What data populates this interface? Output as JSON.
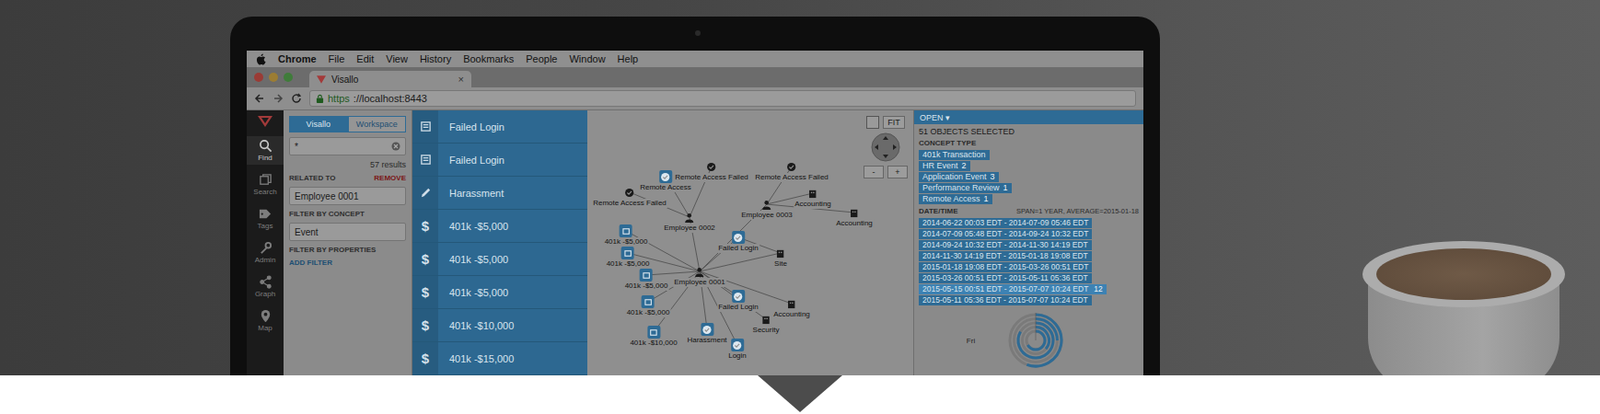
{
  "menubar": {
    "app": "Chrome",
    "items": [
      "File",
      "Edit",
      "View",
      "History",
      "Bookmarks",
      "People",
      "Window",
      "Help"
    ]
  },
  "browser": {
    "tab": {
      "title": "Visallo",
      "close": "×"
    },
    "url": {
      "scheme": "https",
      "rest": "://localhost:8443"
    }
  },
  "nav": [
    {
      "label": "Find",
      "selected": true
    },
    {
      "label": "Search",
      "selected": false
    },
    {
      "label": "Tags",
      "selected": false
    },
    {
      "label": "Admin",
      "selected": false
    },
    {
      "label": "Graph",
      "selected": false
    },
    {
      "label": "Map",
      "selected": false
    }
  ],
  "search": {
    "tabs": [
      {
        "label": "Visallo",
        "selected": true
      },
      {
        "label": "Workspace",
        "selected": false
      }
    ],
    "query": "*",
    "results_count": "57 results",
    "related_label": "RELATED TO",
    "remove": "REMOVE",
    "related_value": "Employee 0001",
    "concept_label": "FILTER BY CONCEPT",
    "concept_value": "Event",
    "properties_label": "FILTER BY PROPERTIES",
    "add_filter": "ADD FILTER"
  },
  "results": [
    {
      "kind": "document",
      "label": "Failed Login"
    },
    {
      "kind": "document",
      "label": "Failed Login"
    },
    {
      "kind": "pencil",
      "label": "Harassment"
    },
    {
      "kind": "money",
      "glyph": "$",
      "label": "401k -$5,000"
    },
    {
      "kind": "money",
      "glyph": "$",
      "label": "401k -$5,000"
    },
    {
      "kind": "money",
      "glyph": "$",
      "label": "401k -$5,000"
    },
    {
      "kind": "money",
      "glyph": "$",
      "label": "401k -$10,000"
    },
    {
      "kind": "money",
      "glyph": "$",
      "label": "401k -$15,000"
    }
  ],
  "graph": {
    "controls": {
      "fit": "FIT",
      "zoom_in": "+",
      "zoom_out": "-"
    },
    "nodes": [
      {
        "label": "Remote Access Failed",
        "kind": "event",
        "selected": false
      },
      {
        "label": "Remote Access",
        "kind": "event",
        "selected": true
      },
      {
        "label": "Remote Access Failed",
        "kind": "event",
        "selected": false
      },
      {
        "label": "Remote Access Failed",
        "kind": "event",
        "selected": false
      },
      {
        "label": "Employee 0002",
        "kind": "person",
        "selected": false
      },
      {
        "label": "Employee 0003",
        "kind": "person",
        "selected": false
      },
      {
        "label": "Accounting",
        "kind": "site",
        "selected": false
      },
      {
        "label": "Accounting",
        "kind": "site",
        "selected": false
      },
      {
        "label": "401k -$5,000",
        "kind": "money",
        "selected": true
      },
      {
        "label": "401k -$5,000",
        "kind": "money",
        "selected": true
      },
      {
        "label": "401k -$5,000",
        "kind": "money",
        "selected": true
      },
      {
        "label": "401k -$5,000",
        "kind": "money",
        "selected": true
      },
      {
        "label": "401k -$10,000",
        "kind": "money",
        "selected": true
      },
      {
        "label": "Employee 0001",
        "kind": "person",
        "selected": false
      },
      {
        "label": "Failed Login",
        "kind": "event",
        "selected": true
      },
      {
        "label": "Failed Login",
        "kind": "event",
        "selected": true
      },
      {
        "label": "Harassment",
        "kind": "event",
        "selected": true
      },
      {
        "label": "Login",
        "kind": "event",
        "selected": true
      },
      {
        "label": "Security",
        "kind": "site",
        "selected": false
      },
      {
        "label": "Accounting",
        "kind": "site",
        "selected": false
      },
      {
        "label": "Site",
        "kind": "site",
        "selected": false
      }
    ],
    "edges": [
      [
        13,
        4
      ],
      [
        13,
        5
      ],
      [
        13,
        8
      ],
      [
        13,
        9
      ],
      [
        13,
        10
      ],
      [
        13,
        11
      ],
      [
        13,
        12
      ],
      [
        13,
        14
      ],
      [
        13,
        15
      ],
      [
        13,
        16
      ],
      [
        13,
        17
      ],
      [
        13,
        18
      ],
      [
        13,
        19
      ],
      [
        13,
        20
      ],
      [
        4,
        0
      ],
      [
        4,
        1
      ],
      [
        4,
        2
      ],
      [
        5,
        3
      ],
      [
        5,
        6
      ],
      [
        5,
        7
      ],
      [
        14,
        20
      ]
    ]
  },
  "inspector": {
    "open": "OPEN ▾",
    "selection": "51 OBJECTS SELECTED",
    "concept_label": "CONCEPT TYPE",
    "concepts": [
      {
        "label": "401k Transaction"
      },
      {
        "label": "HR Event",
        "count": "2"
      },
      {
        "label": "Application Event",
        "count": "3"
      },
      {
        "label": "Performance Review",
        "count": "1"
      },
      {
        "label": "Remote Access",
        "count": "1"
      }
    ],
    "date_label": "DATE/TIME",
    "date_summary": "SPAN=1 YEAR, AVERAGE=2015-01-18",
    "dates": [
      {
        "range": "2014-06-22 00:03 EDT - 2014-07-09 05:46 EDT",
        "selected": false
      },
      {
        "range": "2014-07-09 05:48 EDT - 2014-09-24 10:32 EDT",
        "selected": false
      },
      {
        "range": "2014-09-24 10:32 EDT - 2014-11-30 14:19 EDT",
        "selected": false
      },
      {
        "range": "2014-11-30 14:19 EDT - 2015-01-18 19:08 EDT",
        "selected": false
      },
      {
        "range": "2015-01-18 19:08 EDT - 2015-03-26 00:51 EDT",
        "selected": false
      },
      {
        "range": "2015-03-26 00:51 EDT - 2015-05-11 05:36 EDT",
        "selected": false
      },
      {
        "range": "2015-05-15 00:51 EDT - 2015-07-07 10:24 EDT",
        "selected": true,
        "count": "12"
      },
      {
        "range": "2015-05-11 05:36 EDT - 2015-07-07 10:24 EDT",
        "selected": false
      }
    ],
    "chart": {
      "day_label": "Fri",
      "values": [
        240,
        130,
        300,
        90,
        200
      ]
    }
  }
}
